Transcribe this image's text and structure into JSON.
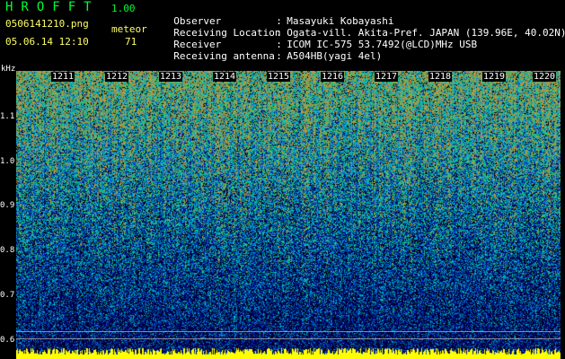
{
  "header": {
    "title": "HROFFT",
    "version": "1.00",
    "filename": "0506141210.png",
    "meteor_label": "meteor",
    "timestamp": "05.06.14 12:10",
    "meteor_count": "71"
  },
  "info": [
    {
      "key": "Observer",
      "value": "Masayuki Kobayashi"
    },
    {
      "key": "Receiving Location",
      "value": "Ogata-vill. Akita-Pref. JAPAN (139.96E, 40.02N)"
    },
    {
      "key": "Receiver",
      "value": "ICOM IC-575 53.7492(@LCD)MHz USB"
    },
    {
      "key": "Receiving antenna",
      "value": "A504HB(yagi 4el)"
    }
  ],
  "axis": {
    "unit": "kHz",
    "y_ticks": [
      "1.1",
      "1.0",
      "0.9",
      "0.8",
      "0.7",
      "0.6"
    ],
    "time_ticks": [
      "1211",
      "1212",
      "1213",
      "1214",
      "1215",
      "1216",
      "1217",
      "1218",
      "1219",
      "1220"
    ]
  },
  "colors": {
    "label_green": "#00ff33",
    "label_yellow": "#ffff66",
    "text_white": "#ffffff",
    "baseline_yellow": "#ffff00"
  }
}
